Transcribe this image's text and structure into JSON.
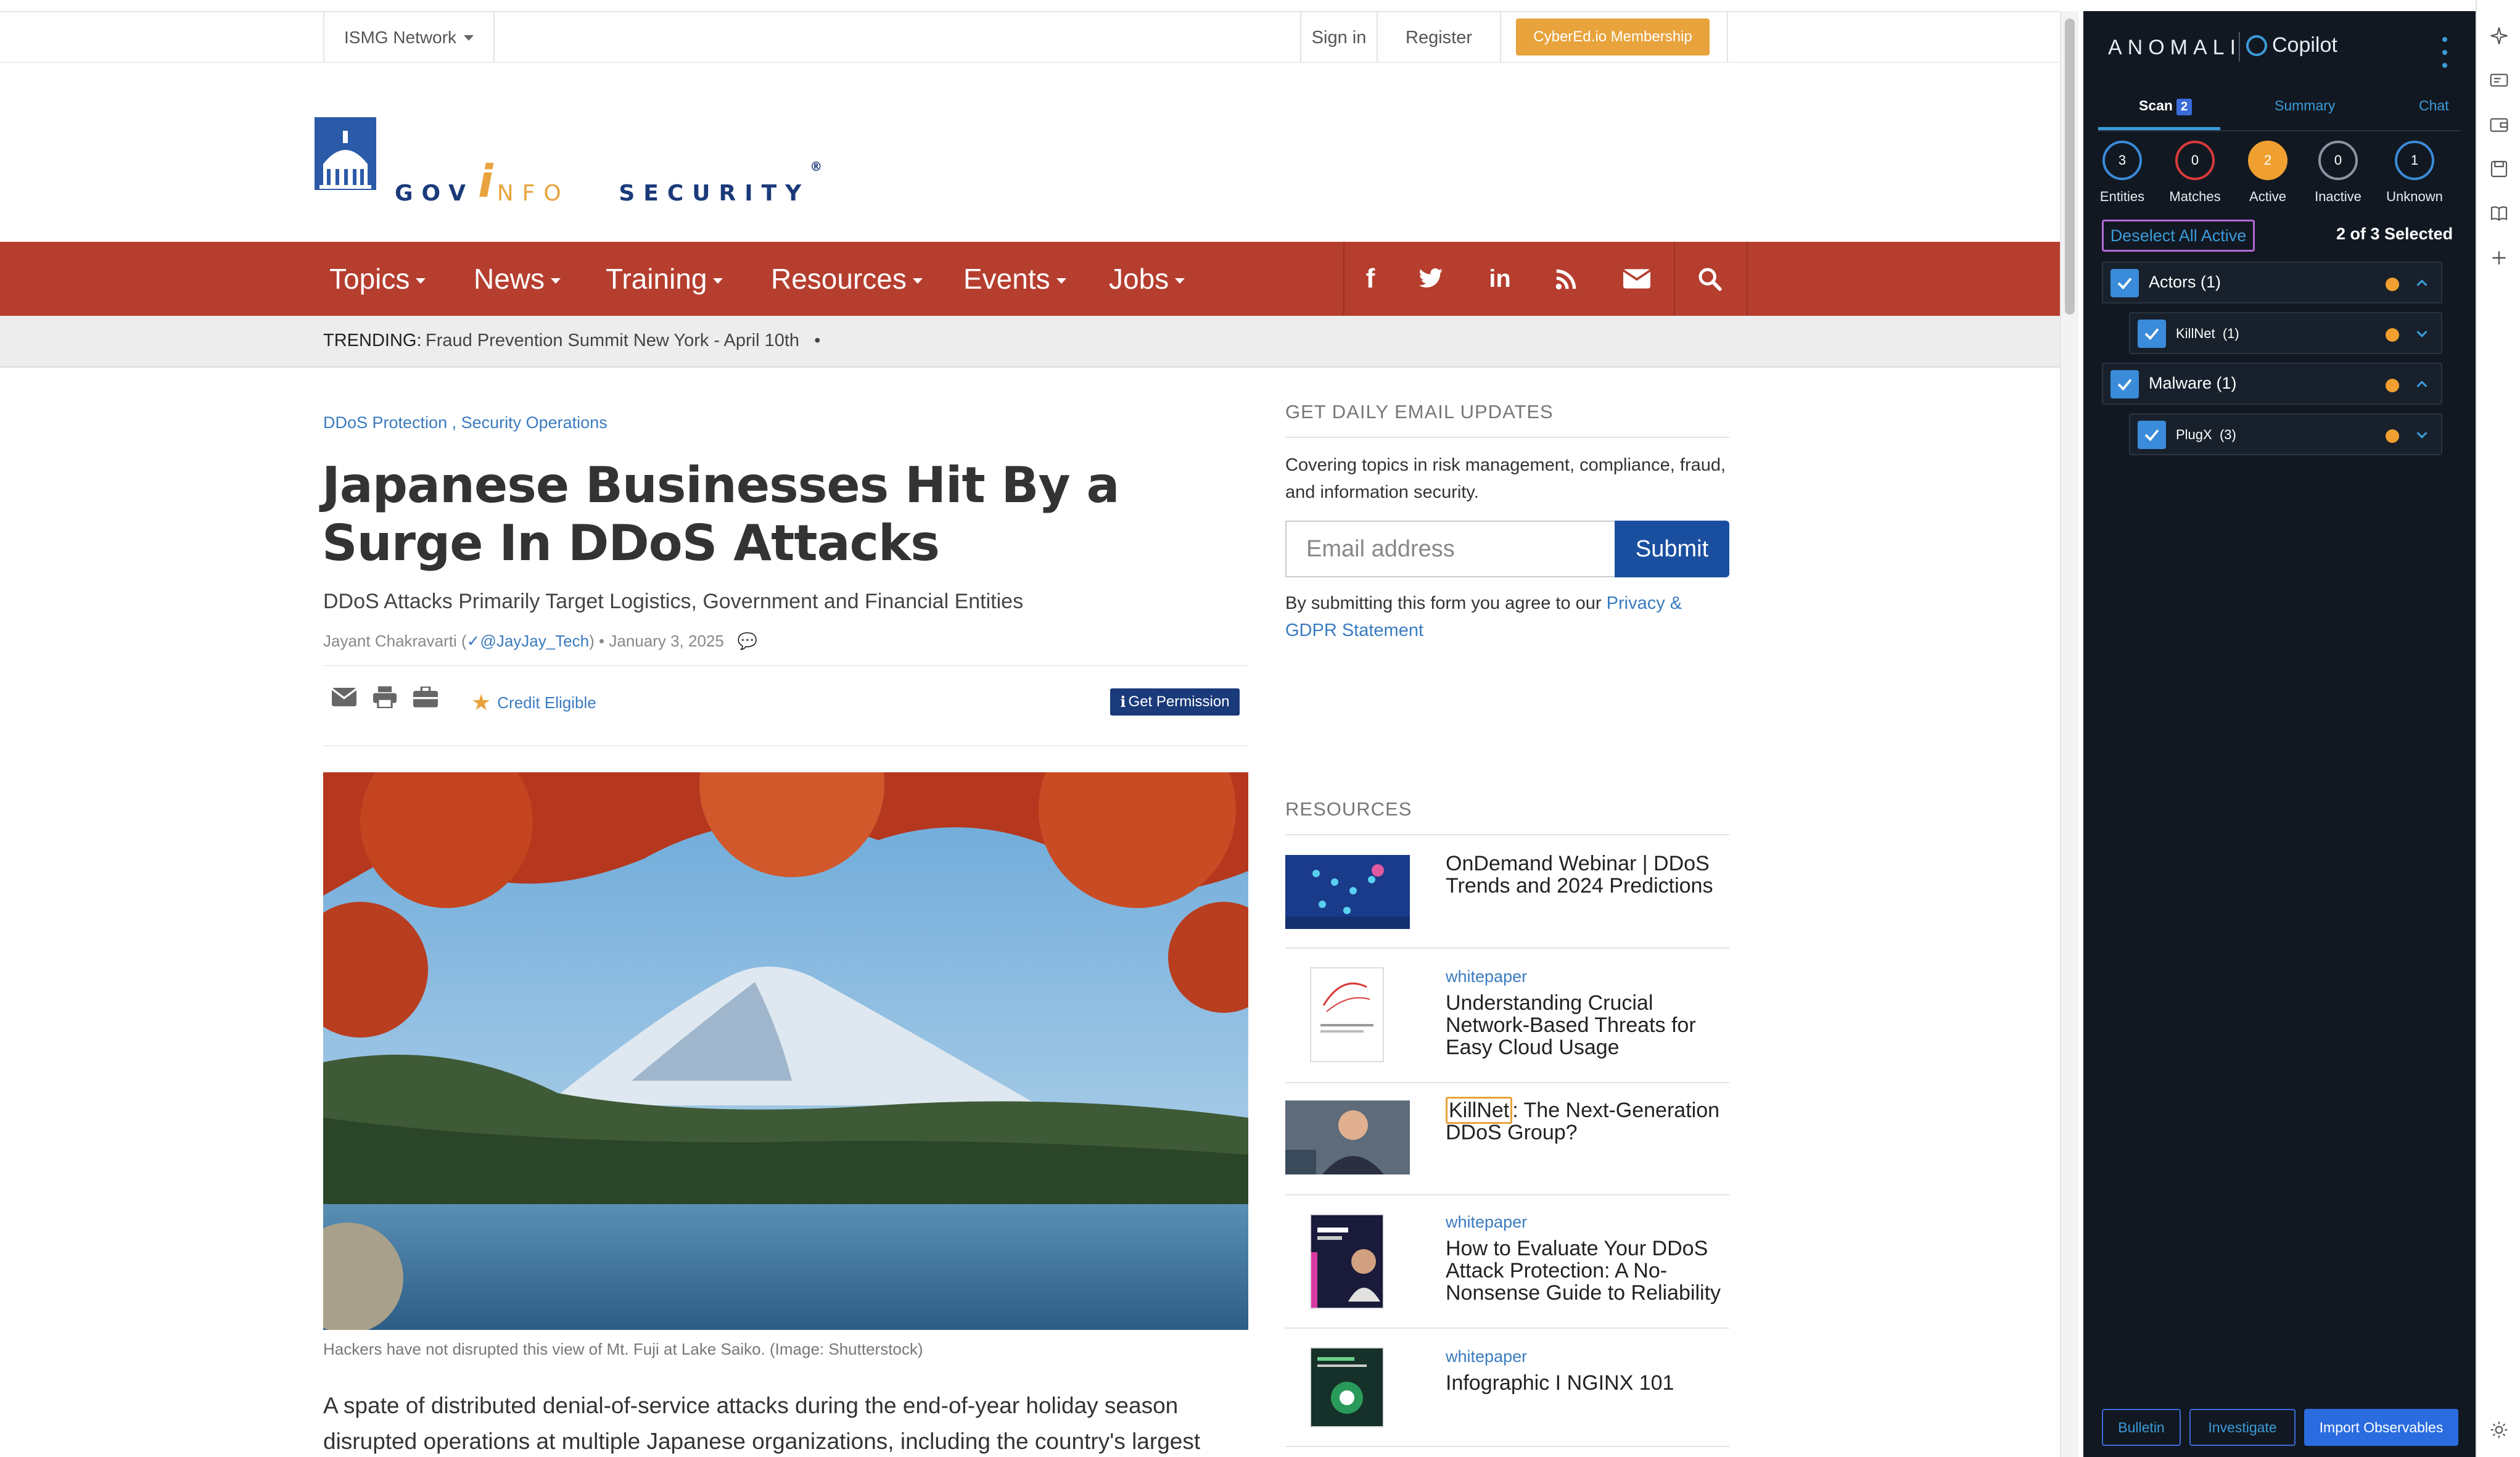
{
  "utility": {
    "network": "ISMG Network",
    "sign_in": "Sign in",
    "register": "Register",
    "membership": "CyberEd.io Membership"
  },
  "logo": {
    "part1": "GOV",
    "part2": "i",
    "part3": "NFO",
    "part4": "SECURITY",
    "mark": "®"
  },
  "nav": {
    "items": [
      "Topics",
      "News",
      "Training",
      "Resources",
      "Events",
      "Jobs"
    ],
    "icons": [
      "facebook-icon",
      "twitter-icon",
      "linkedin-icon",
      "rss-icon",
      "mail-icon",
      "search-icon"
    ]
  },
  "trending": {
    "label": "TRENDING:",
    "text": "Fraud Prevention Summit New York - April 10th",
    "bullet": "•"
  },
  "article": {
    "cat1": "DDoS Protection",
    "cat_sep": " , ",
    "cat2": "Security Operations",
    "title": "Japanese Businesses Hit By a Surge In DDoS Attacks",
    "subtitle": "DDoS Attacks Primarily Target Logistics, Government and Financial Entities",
    "author": "Jayant Chakravarti (",
    "twitter": "@JayJay_Tech",
    "date": ") • January 3, 2025",
    "credit": "Credit Eligible",
    "permission": "Get Permission",
    "caption": "Hackers have not disrupted this view of Mt. Fuji at Lake Saiko. (Image: Shutterstock)",
    "body": "A spate of distributed denial-of-service attacks during the end-of-year holiday season disrupted operations at multiple Japanese organizations, including the country's largest"
  },
  "sidebar": {
    "email_heading": "GET DAILY EMAIL UPDATES",
    "email_desc": "Covering topics in risk management, compliance, fraud, and information security.",
    "email_placeholder": "Email address",
    "submit": "Submit",
    "agree_text": "By submitting this form you agree to our ",
    "agree_link": "Privacy & GDPR Statement",
    "resources_heading": "RESOURCES",
    "resources": [
      {
        "tag": "",
        "title": "OnDemand Webinar | DDoS Trends and 2024 Predictions"
      },
      {
        "tag": "whitepaper",
        "title": "Understanding Crucial Network-Based Threats for Easy Cloud Usage"
      },
      {
        "tag": "",
        "title_hl": "KillNet",
        "title": ": The Next-Generation DDoS Group?"
      },
      {
        "tag": "whitepaper",
        "title": "How to Evaluate Your DDoS Attack Protection: A No-Nonsense Guide to Reliability"
      },
      {
        "tag": "whitepaper",
        "title": "Infographic I NGINX 101"
      }
    ]
  },
  "panel": {
    "brand": "ANOMALI",
    "copilot": "Copilot",
    "tabs": {
      "scan": "Scan",
      "scan_badge": "2",
      "summary": "Summary",
      "chat": "Chat"
    },
    "stats": [
      {
        "value": "3",
        "label": "Entities",
        "color": "#3a8bd9"
      },
      {
        "value": "0",
        "label": "Matches",
        "color": "#d93a3a"
      },
      {
        "value": "2",
        "label": "Active",
        "color": "#f0a030"
      },
      {
        "value": "0",
        "label": "Inactive",
        "color": "#8a94a3"
      },
      {
        "value": "1",
        "label": "Unknown",
        "color": "#3a8bd9"
      }
    ],
    "deselect": "Deselect All Active",
    "selected": "2 of 3 Selected",
    "groups": [
      {
        "label": "Actors (1)",
        "child": "KillNet",
        "child_count": "(1)"
      },
      {
        "label": "Malware (1)",
        "child": "PlugX",
        "child_count": "(3)"
      }
    ],
    "buttons": {
      "bulletin": "Bulletin",
      "investigate": "Investigate",
      "import": "Import Observables"
    }
  }
}
